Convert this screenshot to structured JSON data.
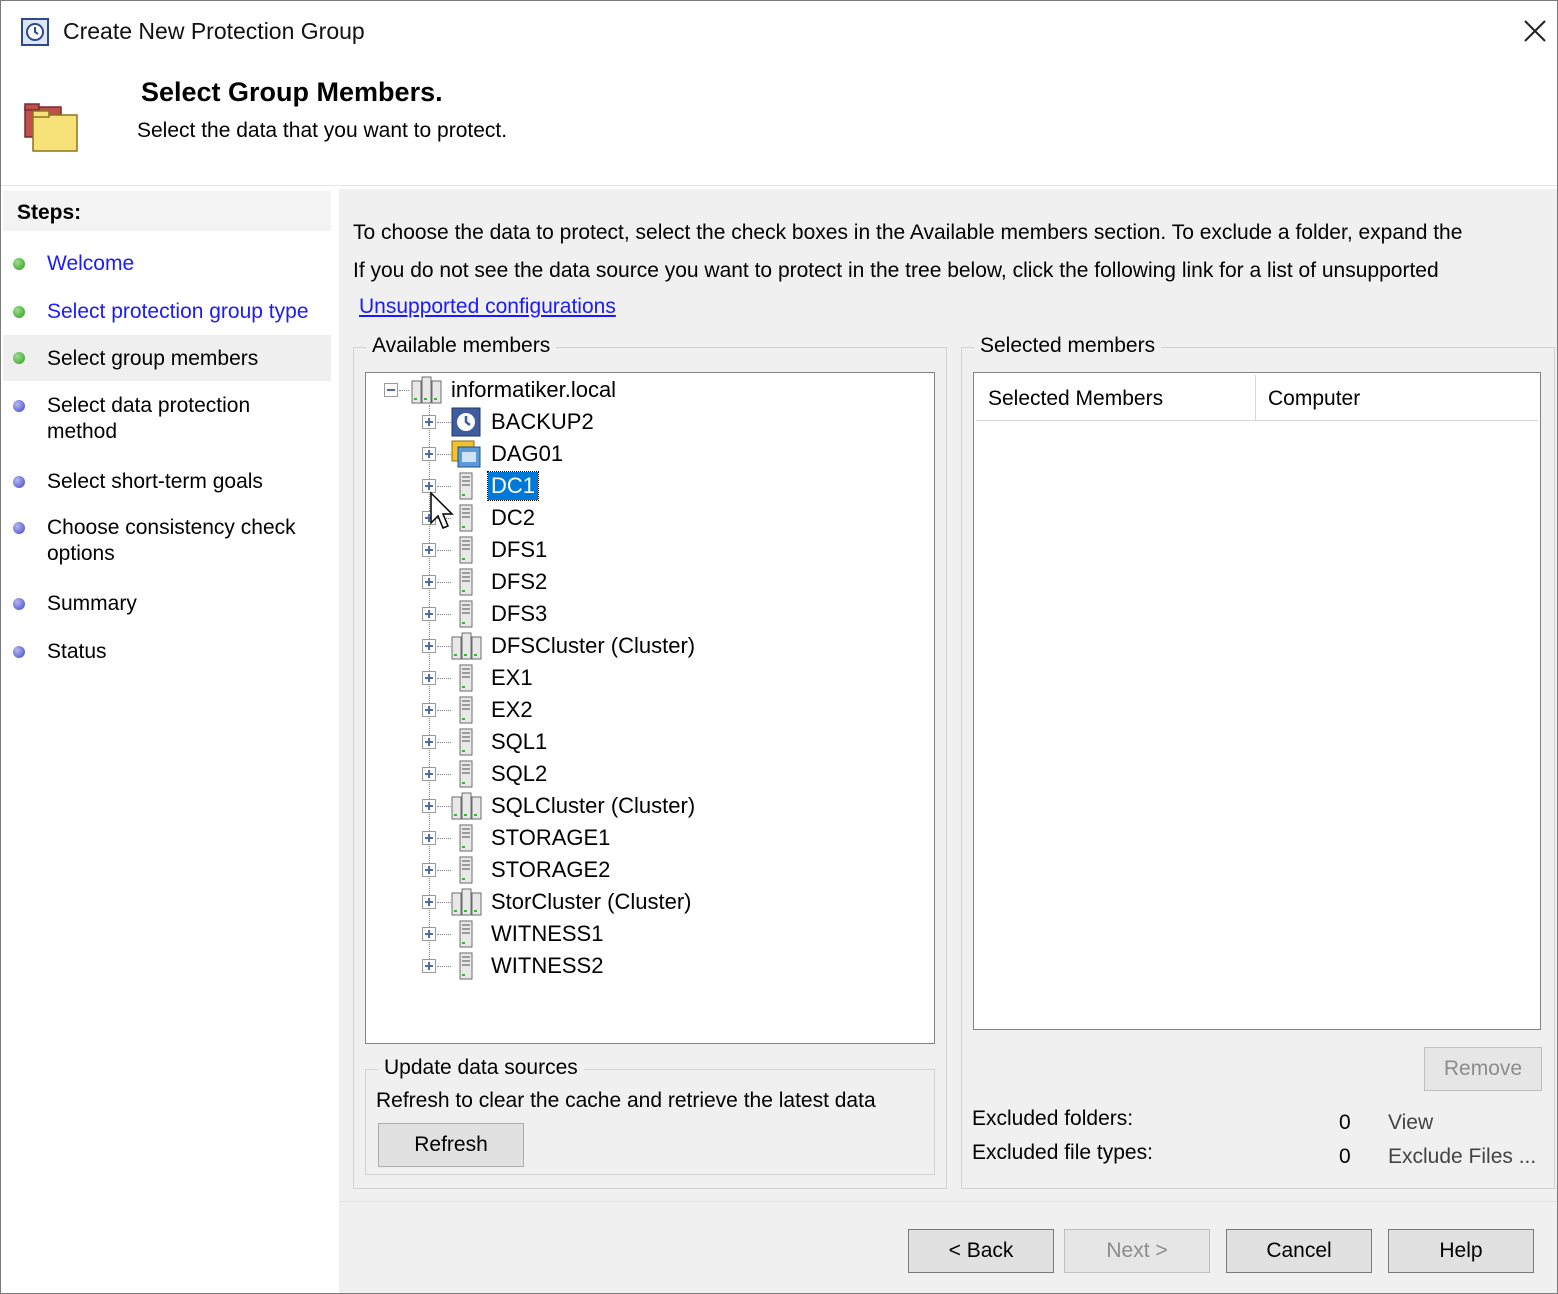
{
  "window": {
    "title": "Create New Protection Group"
  },
  "header": {
    "title": "Select Group Members.",
    "subtitle": "Select the data that you want to protect."
  },
  "steps": {
    "title": "Steps:",
    "items": [
      {
        "label": "Welcome",
        "state": "done-link"
      },
      {
        "label": "Select protection group type",
        "state": "done-link"
      },
      {
        "label": "Select group members",
        "state": "current"
      },
      {
        "label": "Select data protection method",
        "state": "pending"
      },
      {
        "label": "Select short-term goals",
        "state": "pending"
      },
      {
        "label": "Choose consistency check options",
        "state": "pending"
      },
      {
        "label": "Summary",
        "state": "pending"
      },
      {
        "label": "Status",
        "state": "pending"
      }
    ]
  },
  "instructions": {
    "line1": "To choose the data to protect, select the check boxes in the Available members section. To exclude a folder, expand the",
    "line2": "If you do not see the data source you want to protect in the tree below, click the following link for a list of unsupported",
    "link": "Unsupported configurations"
  },
  "available": {
    "label": "Available members",
    "root": "informatiker.local",
    "items": [
      {
        "name": "BACKUP2",
        "icon": "dpm-server-icon"
      },
      {
        "name": "DAG01",
        "icon": "exchange-dag-icon"
      },
      {
        "name": "DC1",
        "icon": "server-icon",
        "selected": true
      },
      {
        "name": "DC2",
        "icon": "server-icon"
      },
      {
        "name": "DFS1",
        "icon": "server-icon"
      },
      {
        "name": "DFS2",
        "icon": "server-icon"
      },
      {
        "name": "DFS3",
        "icon": "server-icon"
      },
      {
        "name": "DFSCluster (Cluster)",
        "icon": "cluster-icon"
      },
      {
        "name": "EX1",
        "icon": "server-icon"
      },
      {
        "name": "EX2",
        "icon": "server-icon"
      },
      {
        "name": "SQL1",
        "icon": "server-icon"
      },
      {
        "name": "SQL2",
        "icon": "server-icon"
      },
      {
        "name": "SQLCluster (Cluster)",
        "icon": "cluster-icon"
      },
      {
        "name": "STORAGE1",
        "icon": "server-icon"
      },
      {
        "name": "STORAGE2",
        "icon": "server-icon"
      },
      {
        "name": "StorCluster (Cluster)",
        "icon": "cluster-icon"
      },
      {
        "name": "WITNESS1",
        "icon": "server-icon"
      },
      {
        "name": "WITNESS2",
        "icon": "server-icon"
      }
    ]
  },
  "update": {
    "label": "Update data sources",
    "text": "Refresh to clear the cache and retrieve the latest data",
    "refresh": "Refresh"
  },
  "selected": {
    "label": "Selected members",
    "col1": "Selected Members",
    "col2": "Computer",
    "remove": "Remove",
    "excluded_folders_label": "Excluded folders:",
    "excluded_folders_count": "0",
    "view": "View",
    "excluded_types_label": "Excluded file types:",
    "excluded_types_count": "0",
    "exclude_files": "Exclude Files ..."
  },
  "footer": {
    "back": "< Back",
    "next": "Next >",
    "cancel": "Cancel",
    "help": "Help"
  }
}
